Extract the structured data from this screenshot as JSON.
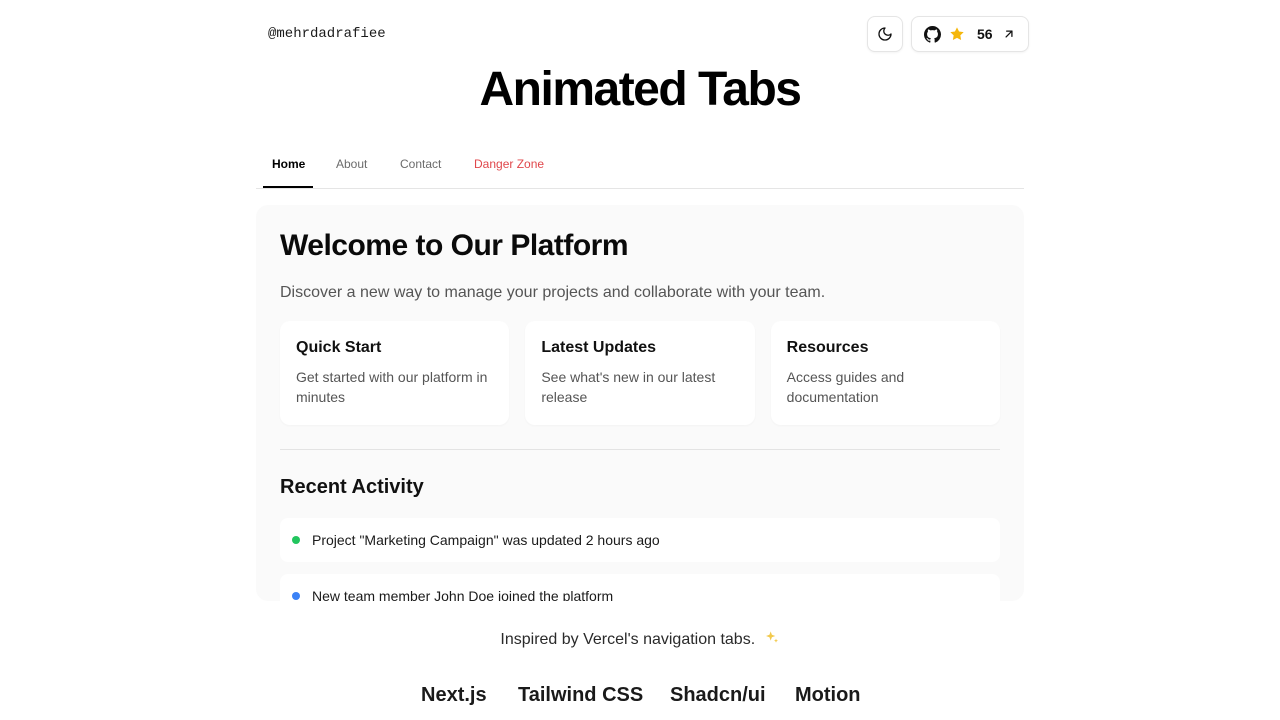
{
  "header": {
    "handle": "@mehrdadrafiee",
    "theme_icon": "moon-icon",
    "github": {
      "icon": "github-icon",
      "star_icon": "star-icon",
      "stars": "56",
      "link_icon": "arrow-up-right-icon"
    }
  },
  "title": "Animated Tabs",
  "tabs": [
    {
      "label": "Home",
      "active": true
    },
    {
      "label": "About",
      "active": false
    },
    {
      "label": "Contact",
      "active": false
    },
    {
      "label": "Danger Zone",
      "active": false,
      "danger": true
    }
  ],
  "panel": {
    "heading": "Welcome to Our Platform",
    "subtitle": "Discover a new way to manage your projects and collaborate with your team.",
    "cards": [
      {
        "title": "Quick Start",
        "text": "Get started with our platform in minutes"
      },
      {
        "title": "Latest Updates",
        "text": "See what's new in our latest release"
      },
      {
        "title": "Resources",
        "text": "Access guides and documentation"
      }
    ],
    "recent_heading": "Recent Activity",
    "activities": [
      {
        "text": "Project \"Marketing Campaign\" was updated 2 hours ago",
        "color": "#22c55e"
      },
      {
        "text": "New team member John Doe joined the platform",
        "color": "#3b82f6"
      }
    ]
  },
  "footer": {
    "note": "Inspired by Vercel's navigation tabs.",
    "sparkle_icon": "sparkles-icon",
    "tech": [
      "Next.js",
      "Tailwind CSS",
      "Shadcn/ui",
      "Motion"
    ]
  },
  "colors": {
    "danger": "#e0474b",
    "star": "#f5b70b",
    "panel_bg": "#fafafa"
  }
}
